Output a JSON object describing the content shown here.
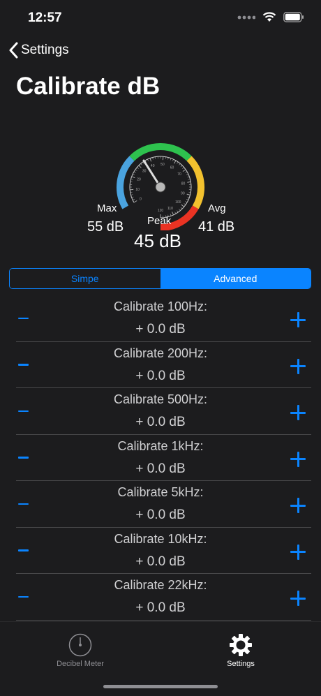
{
  "status": {
    "time": "12:57"
  },
  "nav": {
    "back_label": "Settings"
  },
  "title": "Calibrate dB",
  "gauge": {
    "max_label": "Max",
    "max_value": "55 dB",
    "avg_label": "Avg",
    "avg_value": "41 dB",
    "peak_label": "Peak",
    "peak_value": "45 dB",
    "ticks": [
      "0",
      "10",
      "20",
      "30",
      "40",
      "50",
      "60",
      "70",
      "80",
      "90",
      "100",
      "110",
      "120"
    ],
    "colors": {
      "blue": "#4aa3df",
      "green": "#2ec24e",
      "yellow": "#f2c12e",
      "red": "#ea3323"
    }
  },
  "segments": {
    "simple": "Simpe",
    "advanced": "Advanced",
    "selected": "Advanced"
  },
  "calibrations": [
    {
      "label": "Calibrate 100Hz:",
      "value": "+ 0.0 dB"
    },
    {
      "label": "Calibrate 200Hz:",
      "value": "+ 0.0 dB"
    },
    {
      "label": "Calibrate 500Hz:",
      "value": "+ 0.0 dB"
    },
    {
      "label": "Calibrate 1kHz:",
      "value": "+ 0.0 dB"
    },
    {
      "label": "Calibrate 5kHz:",
      "value": "+ 0.0 dB"
    },
    {
      "label": "Calibrate 10kHz:",
      "value": "+ 0.0 dB"
    },
    {
      "label": "Calibrate 22kHz:",
      "value": "+ 0.0 dB"
    }
  ],
  "tabs": {
    "meter_label": "Decibel Meter",
    "settings_label": "Settings",
    "selected": "Settings"
  },
  "accent": "#0a84ff"
}
